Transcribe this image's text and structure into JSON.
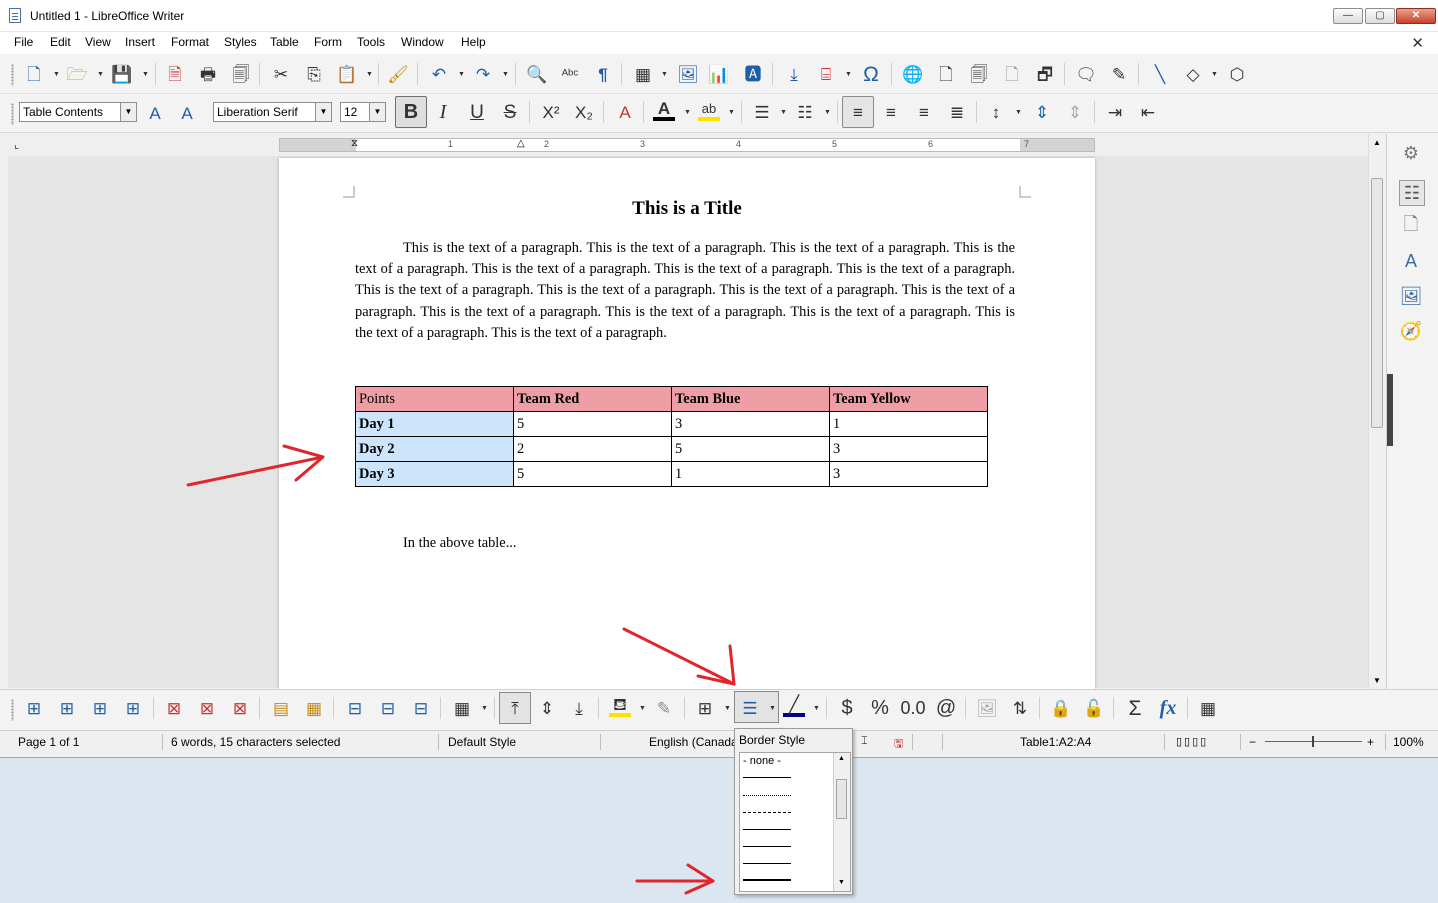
{
  "window": {
    "title": "Untitled 1 - LibreOffice Writer",
    "min_label": "—",
    "max_label": "▢",
    "close_label": "✕"
  },
  "menu": [
    "File",
    "Edit",
    "View",
    "Insert",
    "Format",
    "Styles",
    "Table",
    "Form",
    "Tools",
    "Window",
    "Help"
  ],
  "doc_close": "✕",
  "formatting": {
    "paragraph_style": "Table Contents",
    "font_name": "Liberation Serif",
    "font_size": "12"
  },
  "ruler": {
    "labels": [
      "1",
      "2",
      "3",
      "4",
      "5",
      "6",
      "7"
    ]
  },
  "document": {
    "title": "This is a Title",
    "paragraph": "This is the text of a paragraph.  This is the text of a paragraph.  This is the text of a paragraph.  This is the text of a paragraph.  This is the text of a paragraph.  This is the text of a paragraph.  This is the text of a paragraph.  This is the text of a paragraph.  This is the text of a paragraph.  This is the text of a paragraph.  This is the text of a paragraph.  This is the text of a paragraph.  This is the text of a paragraph.  This is the text of a paragraph.  This is the text of a paragraph.  This is the text of a paragraph.",
    "table": {
      "header": [
        "Points",
        "Team Red",
        "Team Blue",
        "Team Yellow"
      ],
      "rows": [
        [
          "Day 1",
          "5",
          "3",
          "1"
        ],
        [
          "Day 2",
          "2",
          "5",
          "3"
        ],
        [
          "Day 3",
          "5",
          "1",
          "3"
        ]
      ]
    },
    "after_text": "In the above table..."
  },
  "statusbar": {
    "page": "Page 1 of 1",
    "words": "6 words, 15 characters selected",
    "page_style": "Default Style",
    "language": "English (Canada)",
    "cell_ref": "Table1:A2:A4",
    "zoom": "100%"
  },
  "border_popup": {
    "title": "Border Style",
    "options": [
      "- none -"
    ]
  },
  "colors": {
    "header_fill": "#ee9ea4",
    "selection": "#cce5fb",
    "arrow": "#e0262b"
  }
}
